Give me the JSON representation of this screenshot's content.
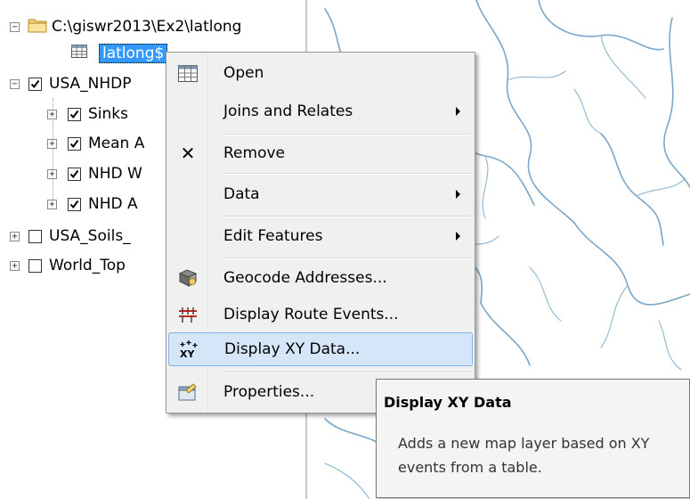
{
  "toc": {
    "items": [
      {
        "label": "C:\\giswr2013\\Ex2\\latlong",
        "type": "folder",
        "expander": "−"
      },
      {
        "label": "latlong$",
        "type": "table",
        "selected": true
      },
      {
        "label": "USA_NHDP",
        "type": "layer",
        "checked": true,
        "expander": "−"
      },
      {
        "label": "Sinks",
        "type": "sublayer",
        "checked": true,
        "expander": "+"
      },
      {
        "label": "Mean A",
        "type": "sublayer",
        "checked": true,
        "expander": "+"
      },
      {
        "label": "NHD W",
        "type": "sublayer",
        "checked": true,
        "expander": "+"
      },
      {
        "label": "NHD A",
        "type": "sublayer",
        "checked": true,
        "expander": "+"
      },
      {
        "label": "USA_Soils_",
        "type": "layer",
        "checked": false,
        "expander": "+"
      },
      {
        "label": "World_Top",
        "type": "layer",
        "checked": false,
        "expander": "+"
      }
    ]
  },
  "context_menu": {
    "items": [
      {
        "label": "Open",
        "icon": "table-icon"
      },
      {
        "label": "Joins and Relates",
        "submenu": true
      },
      {
        "label": "Remove",
        "icon": "remove-x-icon"
      },
      {
        "label": "Data",
        "submenu": true
      },
      {
        "label": "Edit Features",
        "submenu": true
      },
      {
        "label": "Geocode Addresses...",
        "icon": "geocode-icon"
      },
      {
        "label": "Display Route Events...",
        "icon": "route-events-icon"
      },
      {
        "label": "Display XY Data...",
        "icon": "xy-data-icon",
        "highlighted": true
      },
      {
        "label": "Properties...",
        "icon": "properties-icon"
      }
    ]
  },
  "tooltip": {
    "title": "Display XY Data",
    "description": "Adds a new map layer based on XY events from a table."
  },
  "colors": {
    "selection": "#3399ff",
    "menu_highlight": "#d5e6f8",
    "river": "#7aa6c8"
  }
}
